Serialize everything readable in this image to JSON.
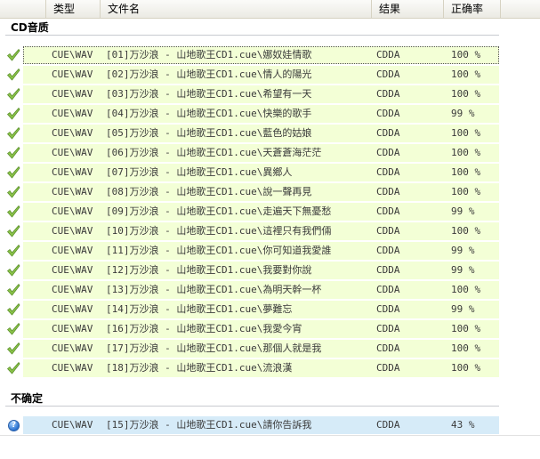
{
  "header": {
    "type_label": "类型",
    "name_label": "文件名",
    "result_label": "结果",
    "accuracy_label": "正确率"
  },
  "groups": [
    {
      "title": "CD音质",
      "status_icon": "check-icon",
      "status_color": "#7cb342",
      "rows": [
        {
          "type": "CUE\\WAV",
          "name": "[01]万沙浪 - 山地歌王CD1.cue\\娜奴娃情歌",
          "result": "CDDA",
          "accuracy": "100 %"
        },
        {
          "type": "CUE\\WAV",
          "name": "[02]万沙浪 - 山地歌王CD1.cue\\情人的陽光",
          "result": "CDDA",
          "accuracy": "100 %"
        },
        {
          "type": "CUE\\WAV",
          "name": "[03]万沙浪 - 山地歌王CD1.cue\\希望有一天",
          "result": "CDDA",
          "accuracy": "100 %"
        },
        {
          "type": "CUE\\WAV",
          "name": "[04]万沙浪 - 山地歌王CD1.cue\\快樂的歌手",
          "result": "CDDA",
          "accuracy": "99 %"
        },
        {
          "type": "CUE\\WAV",
          "name": "[05]万沙浪 - 山地歌王CD1.cue\\藍色的姑娘",
          "result": "CDDA",
          "accuracy": "100 %"
        },
        {
          "type": "CUE\\WAV",
          "name": "[06]万沙浪 - 山地歌王CD1.cue\\天蒼蒼海茫茫",
          "result": "CDDA",
          "accuracy": "100 %"
        },
        {
          "type": "CUE\\WAV",
          "name": "[07]万沙浪 - 山地歌王CD1.cue\\異鄉人",
          "result": "CDDA",
          "accuracy": "100 %"
        },
        {
          "type": "CUE\\WAV",
          "name": "[08]万沙浪 - 山地歌王CD1.cue\\說一聲再見",
          "result": "CDDA",
          "accuracy": "100 %"
        },
        {
          "type": "CUE\\WAV",
          "name": "[09]万沙浪 - 山地歌王CD1.cue\\走遍天下無憂愁",
          "result": "CDDA",
          "accuracy": "99 %"
        },
        {
          "type": "CUE\\WAV",
          "name": "[10]万沙浪 - 山地歌王CD1.cue\\這裡只有我們倆",
          "result": "CDDA",
          "accuracy": "100 %"
        },
        {
          "type": "CUE\\WAV",
          "name": "[11]万沙浪 - 山地歌王CD1.cue\\你可知道我愛誰",
          "result": "CDDA",
          "accuracy": "99 %"
        },
        {
          "type": "CUE\\WAV",
          "name": "[12]万沙浪 - 山地歌王CD1.cue\\我要對你說",
          "result": "CDDA",
          "accuracy": "99 %"
        },
        {
          "type": "CUE\\WAV",
          "name": "[13]万沙浪 - 山地歌王CD1.cue\\為明天幹一杯",
          "result": "CDDA",
          "accuracy": "100 %"
        },
        {
          "type": "CUE\\WAV",
          "name": "[14]万沙浪 - 山地歌王CD1.cue\\夢難忘",
          "result": "CDDA",
          "accuracy": "99 %"
        },
        {
          "type": "CUE\\WAV",
          "name": "[16]万沙浪 - 山地歌王CD1.cue\\我愛今宵",
          "result": "CDDA",
          "accuracy": "100 %"
        },
        {
          "type": "CUE\\WAV",
          "name": "[17]万沙浪 - 山地歌王CD1.cue\\那個人就是我",
          "result": "CDDA",
          "accuracy": "100 %"
        },
        {
          "type": "CUE\\WAV",
          "name": "[18]万沙浪 - 山地歌王CD1.cue\\流浪漢",
          "result": "CDDA",
          "accuracy": "100 %"
        }
      ]
    },
    {
      "title": "不确定",
      "status_icon": "question-icon",
      "status_color": "#2a72d0",
      "icon_glyph": "?",
      "rows": [
        {
          "type": "CUE\\WAV",
          "name": "[15]万沙浪 - 山地歌王CD1.cue\\請你告訴我",
          "result": "CDDA",
          "accuracy": "43 %"
        }
      ]
    }
  ]
}
